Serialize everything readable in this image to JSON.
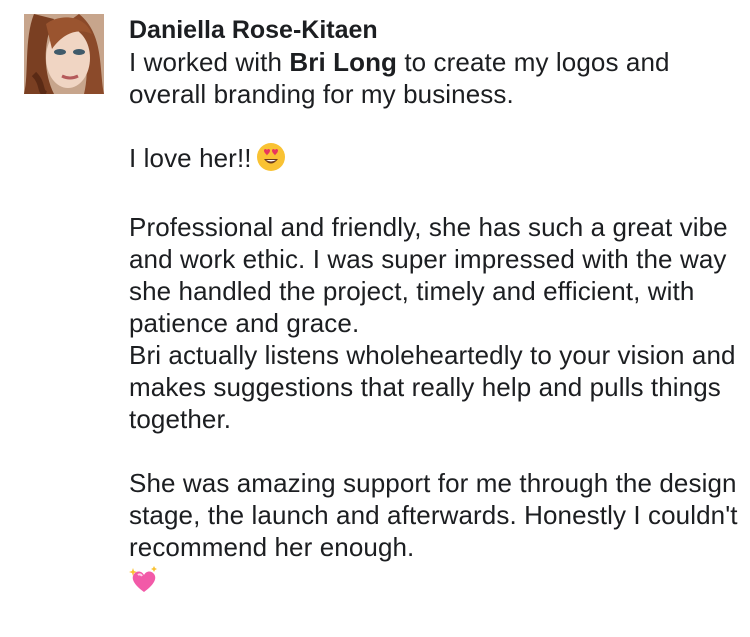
{
  "review": {
    "author": "Daniella Rose-Kitaen",
    "avatar_icon": "profile-photo",
    "intro_prefix": "I worked with ",
    "intro_mention": "Bri Long",
    "intro_suffix": " to create my logos and overall branding for my business.",
    "love_text": "I love her!!",
    "love_emoji": "heart-eyes-emoji",
    "paragraph_professional": "Professional and friendly, she has such a great vibe and work ethic. I was super impressed with the way she handled the project, timely and efficient, with patience and grace.",
    "paragraph_listens": "Bri actually listens wholeheartedly to your vision and makes suggestions that really help and pulls things together.",
    "paragraph_support": "She was amazing support for me through the design stage, the launch and afterwards. Honestly I couldn't recommend her enough.",
    "closing_emoji": "sparkling-heart-emoji"
  },
  "colors": {
    "text": "#1c1e21",
    "background": "#ffffff",
    "emoji_face": "#f9c233",
    "emoji_heart": "#e8365d",
    "sparkle_heart": "#f25aa8"
  }
}
